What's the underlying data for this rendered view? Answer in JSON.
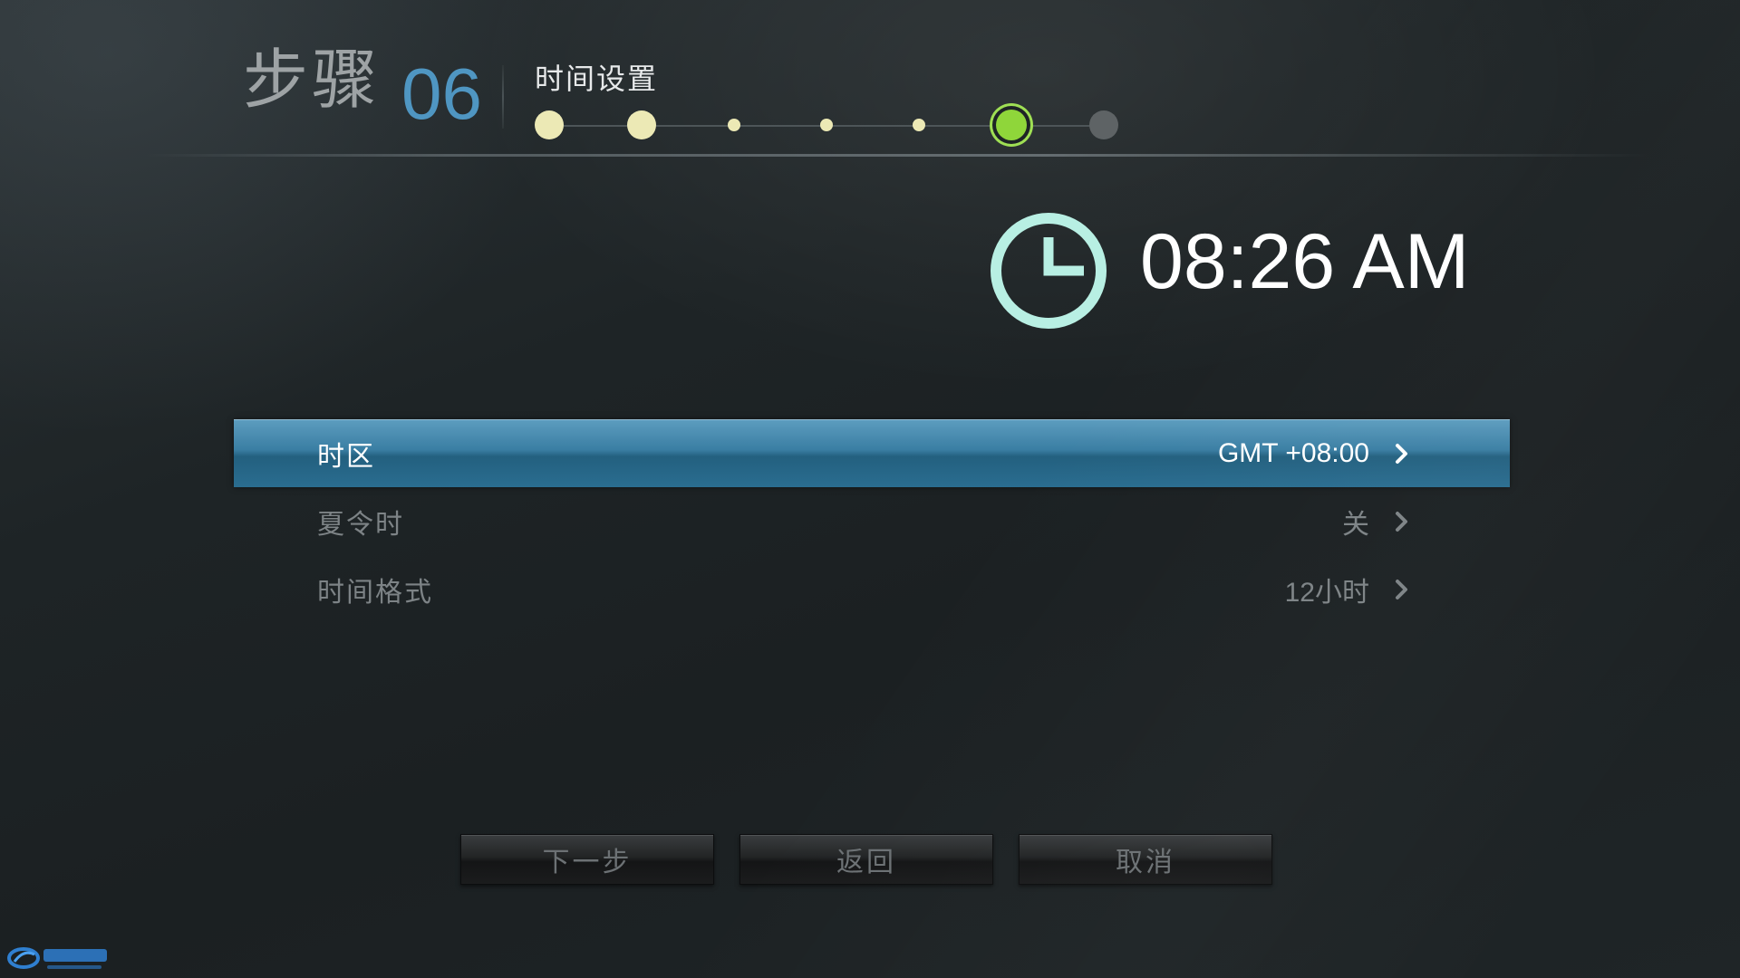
{
  "header": {
    "step_label": "步骤",
    "step_number": "06",
    "page_title": "时间设置",
    "progress": {
      "total_steps": 7,
      "current_step": 6,
      "completed_steps": 5
    }
  },
  "clock": {
    "time": "08:26 AM",
    "icon": "clock-icon"
  },
  "settings": [
    {
      "label": "时区",
      "value": "GMT +08:00",
      "selected": true
    },
    {
      "label": "夏令时",
      "value": "关",
      "selected": false
    },
    {
      "label": "时间格式",
      "value": "12小时",
      "selected": false
    }
  ],
  "buttons": {
    "next": "下一步",
    "back": "返回",
    "cancel": "取消"
  },
  "colors": {
    "accent_blue": "#4f96c2",
    "selected_row": "#3a7ea3",
    "current_step": "#8fd63a",
    "completed_step": "#ece9b5",
    "clock_ring": "#b8efe3"
  }
}
